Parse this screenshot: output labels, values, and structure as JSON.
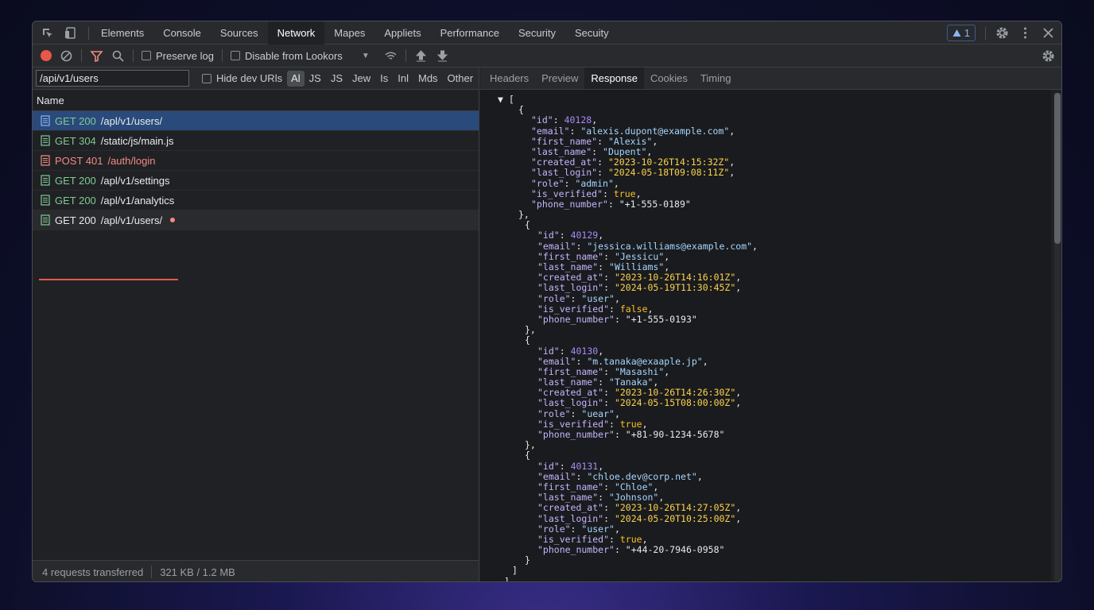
{
  "tabs": [
    "Elements",
    "Console",
    "Sources",
    "Network",
    "Mapes",
    "Appliets",
    "Performance",
    "Security",
    "Secuity"
  ],
  "active_tab": "Network",
  "issues_count": "1",
  "toolbar": {
    "preserve_log": "Preserve log",
    "disable_cache": "Disable from Lookors"
  },
  "filter": {
    "value": "/api/v1/users",
    "hide_label": "Hide dev URls",
    "types": [
      "Al",
      "JS",
      "JS",
      "Jew",
      "Is",
      "Inl",
      "Mds",
      "Other"
    ]
  },
  "column_name": "Name",
  "requests": [
    {
      "method": "GET",
      "status": "200",
      "path": "/apl/v1/users/",
      "kind": "ok"
    },
    {
      "method": "GET",
      "status": "304",
      "path": "/static/js/main.js",
      "kind": "ok"
    },
    {
      "method": "POST",
      "status": "401",
      "path": "/auth/login",
      "kind": "err"
    },
    {
      "method": "GET",
      "status": "200",
      "path": "/apl/v1/settings",
      "kind": "ok"
    },
    {
      "method": "GET",
      "status": "200",
      "path": "/apl/v1/analytics",
      "kind": "ok"
    },
    {
      "method": "GET",
      "status": "200",
      "path": "/apl/v1/users/",
      "kind": "ok"
    }
  ],
  "status": {
    "requests": "4 requests transferred",
    "size": "321 KB / 1.2 MB"
  },
  "detail_tabs": [
    "Headers",
    "Preview",
    "Response",
    "Cookies",
    "Timing"
  ],
  "active_detail_tab": "Response",
  "response": [
    {
      "id": "40128",
      "email": "alexis.dupont@example.com",
      "first_name": "Alexis",
      "last_name": "Dupent",
      "created_at": "2023-10-26T14:15:32Z",
      "last_login": "2024-05-18T09:08:11Z",
      "role": "admin",
      "is_verified": "true",
      "phone_number": "+1-555-0189"
    },
    {
      "id": "40129",
      "email": "jessica.williams@example.com",
      "first_name": "Jessicu",
      "last_name": "Williams",
      "created_at": "2023-10-26T14:16:01Z",
      "last_login": "2024-05-19T11:30:45Z",
      "role": "user",
      "is_verified": "false",
      "phone_number": "+1-555-0193"
    },
    {
      "id": "40130",
      "email": "m.tanaka@exaaple.jp",
      "first_name": "Masashi",
      "last_name": "Tanaka",
      "created_at": "2023-10-26T14:26:30Z",
      "last_login": "2024-05-15T08:00:00Z",
      "role": "uear",
      "is_verified": "true",
      "phone_number": "+81-90-1234-5678"
    },
    {
      "id": "40131",
      "email": "chloe.dev@corp.net",
      "first_name": "Chloe",
      "last_name": "Johnson",
      "created_at": "2023-10-26T14:27:05Z",
      "last_login": "2024-05-20T10:25:00Z",
      "role": "user",
      "is_verified": "true",
      "phone_number": "+44-20-7946-0958"
    }
  ],
  "icons": [
    "inspect-icon",
    "device-icon",
    "gear-icon",
    "more-icon",
    "close-icon",
    "record-icon",
    "clear-icon",
    "filter-icon",
    "search-icon",
    "wifi-icon",
    "upload-icon",
    "download-icon",
    "document-icon"
  ]
}
